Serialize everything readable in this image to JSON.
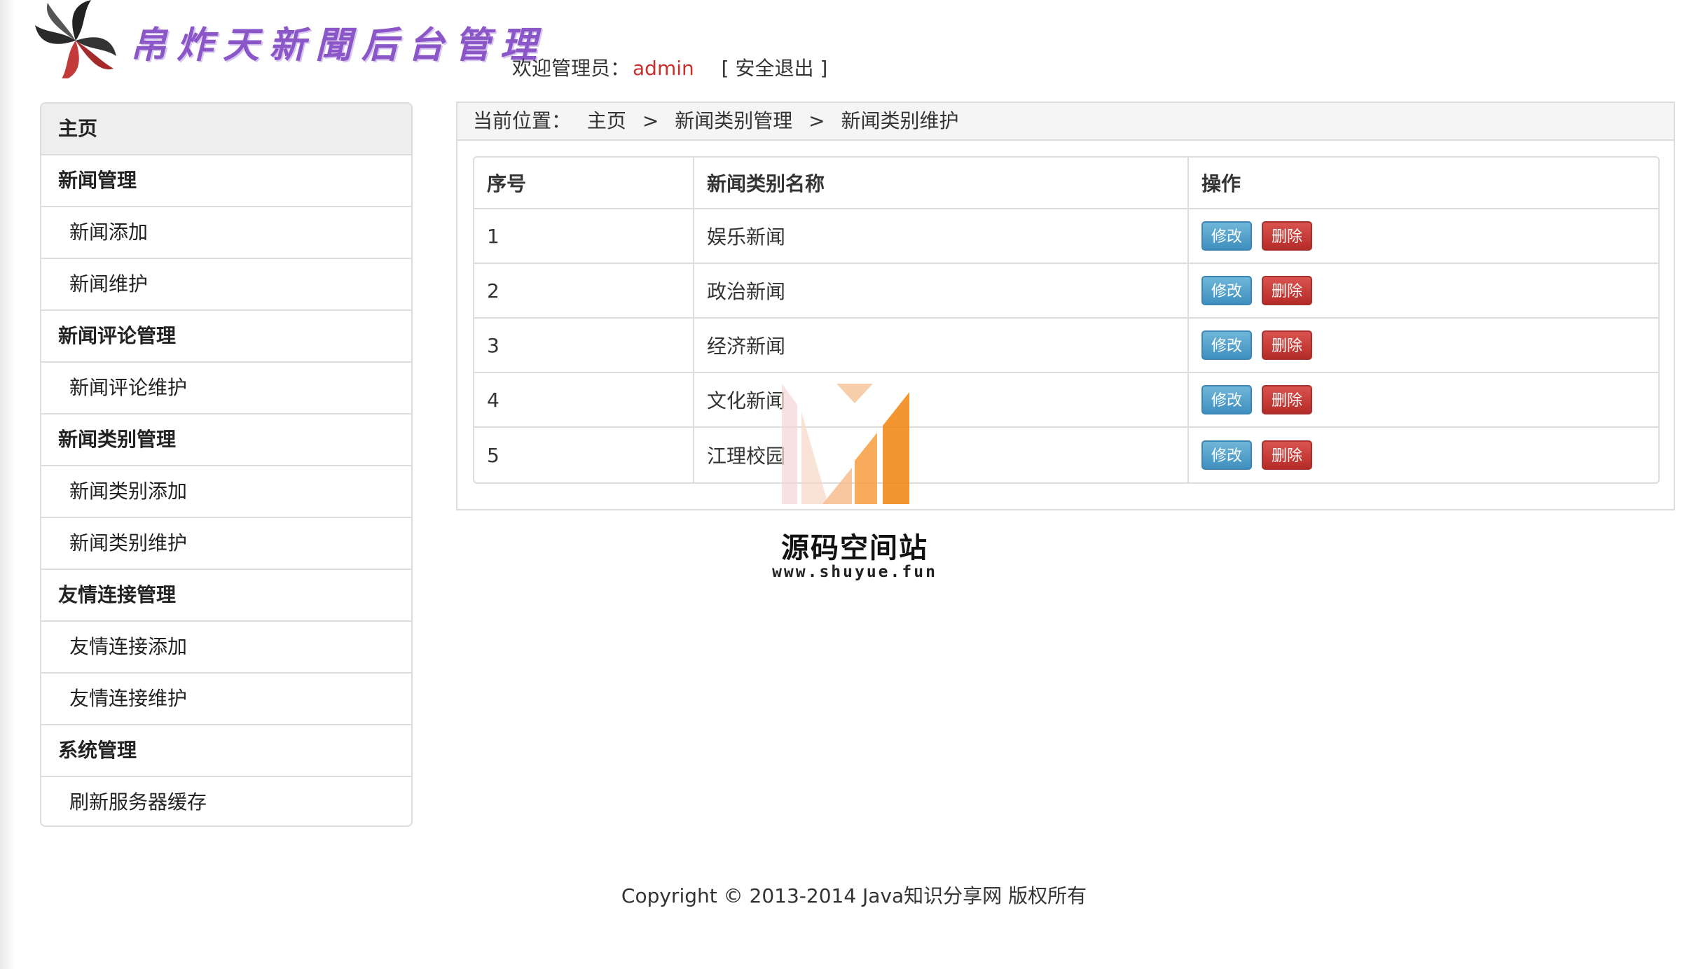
{
  "header": {
    "site_title": "帛炸天新聞后台管理",
    "welcome_prefix": "欢迎管理员：",
    "username": "admin",
    "logout": "[ 安全退出 ]"
  },
  "sidebar": {
    "items": [
      {
        "label": "主页",
        "kind": "home"
      },
      {
        "label": "新闻管理",
        "kind": "group"
      },
      {
        "label": "新闻添加",
        "kind": "sub"
      },
      {
        "label": "新闻维护",
        "kind": "sub"
      },
      {
        "label": "新闻评论管理",
        "kind": "group"
      },
      {
        "label": "新闻评论维护",
        "kind": "sub"
      },
      {
        "label": "新闻类别管理",
        "kind": "group"
      },
      {
        "label": "新闻类别添加",
        "kind": "sub"
      },
      {
        "label": "新闻类别维护",
        "kind": "sub"
      },
      {
        "label": "友情连接管理",
        "kind": "group"
      },
      {
        "label": "友情连接添加",
        "kind": "sub"
      },
      {
        "label": "友情连接维护",
        "kind": "sub"
      },
      {
        "label": "系统管理",
        "kind": "group"
      },
      {
        "label": "刷新服务器缓存",
        "kind": "sub"
      }
    ]
  },
  "breadcrumb": {
    "prefix": "当前位置：",
    "items": [
      "主页",
      "新闻类别管理",
      "新闻类别维护"
    ],
    "separator": ">"
  },
  "table": {
    "headers": [
      "序号",
      "新闻类别名称",
      "操作"
    ],
    "rows": [
      {
        "id": "1",
        "name": "娱乐新闻"
      },
      {
        "id": "2",
        "name": "政治新闻"
      },
      {
        "id": "3",
        "name": "经济新闻"
      },
      {
        "id": "4",
        "name": "文化新闻"
      },
      {
        "id": "5",
        "name": "江理校园"
      }
    ],
    "edit_label": "修改",
    "delete_label": "删除"
  },
  "watermark": {
    "title": "源码空间站",
    "url": "www.shuyue.fun"
  },
  "footer": {
    "text": "Copyright © 2013-2014 Java知识分享网 版权所有"
  },
  "colors": {
    "edit_button": "#4a9ccb",
    "delete_button": "#c9302c",
    "username": "#c9302c",
    "title": "#8a56c8"
  }
}
